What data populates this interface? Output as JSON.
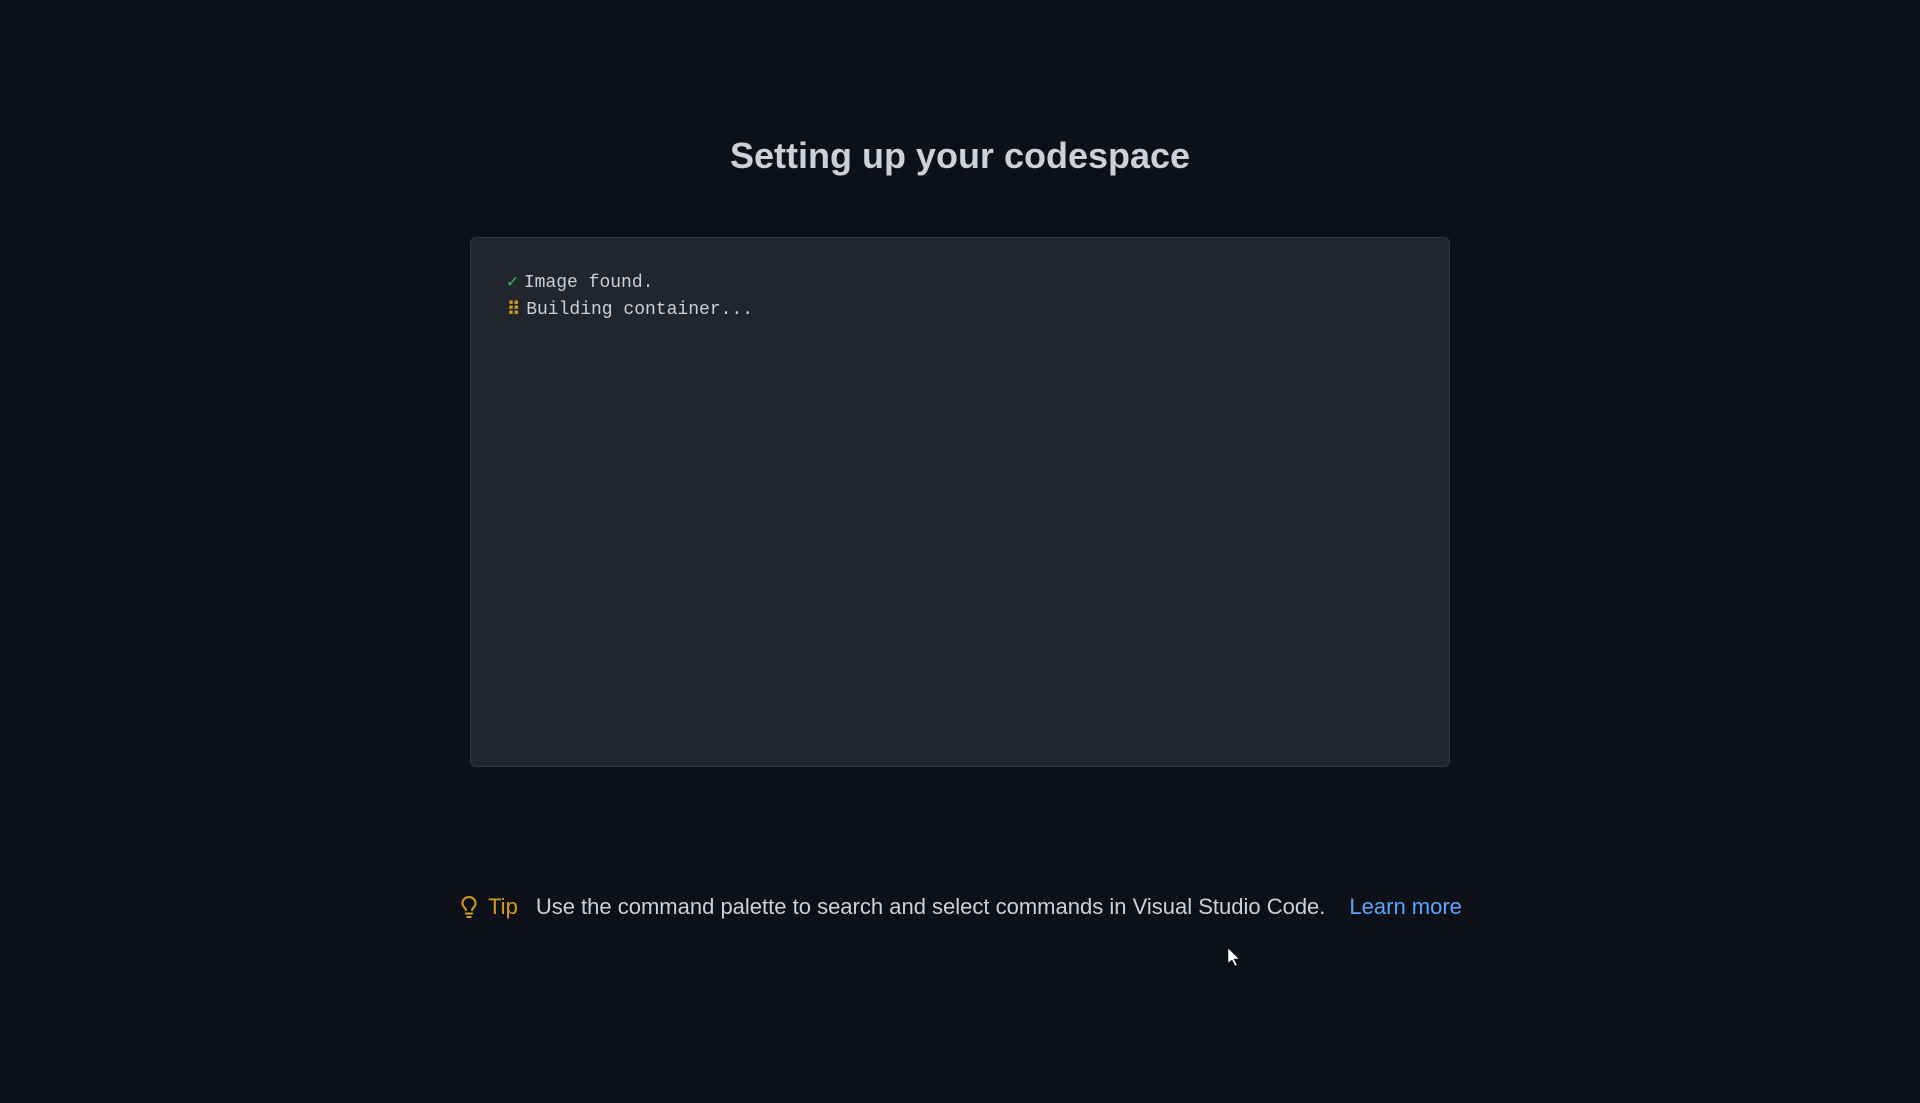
{
  "page": {
    "title": "Setting up your codespace"
  },
  "terminal": {
    "lines": [
      {
        "icon": "check",
        "text": "Image found."
      },
      {
        "icon": "spinner",
        "text": "Building container..."
      }
    ]
  },
  "tip": {
    "label": "Tip",
    "text": "Use the command palette to search and select commands in Visual Studio Code.",
    "link_text": "Learn more"
  },
  "icons": {
    "check_glyph": "✓",
    "spinner_glyph": "⠿"
  },
  "colors": {
    "background": "#0d1117",
    "panel": "#21262d",
    "border": "#30363d",
    "text": "#c9d1d9",
    "success": "#3fb950",
    "warning": "#d29922",
    "link": "#58a6ff"
  }
}
